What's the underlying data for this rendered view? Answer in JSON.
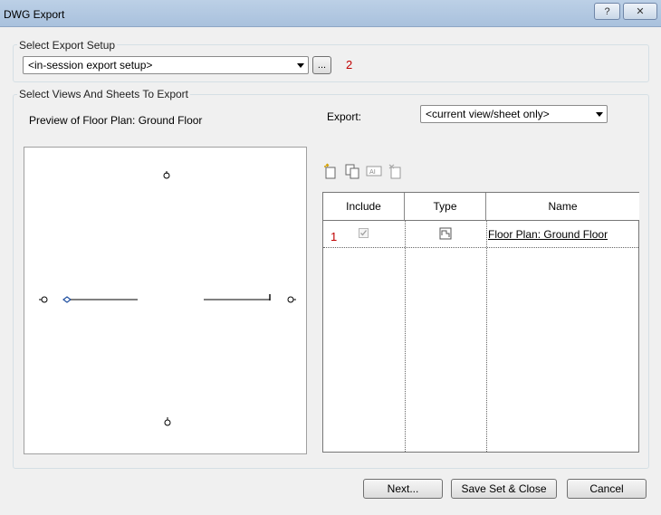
{
  "window": {
    "title": "DWG Export",
    "help_label": "?",
    "close_label": "✕"
  },
  "export_setup": {
    "group_label": "Select Export Setup",
    "selected": "<in-session export setup>",
    "browse_label": "...",
    "annotation": "2"
  },
  "views": {
    "group_label": "Select Views And Sheets To Export",
    "preview_label": "Preview of Floor Plan: Ground Floor",
    "export_label": "Export:",
    "export_selected": "<current view/sheet only>"
  },
  "table": {
    "headers": [
      "Include",
      "Type",
      "Name"
    ],
    "rows": [
      {
        "annotation": "1",
        "include": true,
        "name": "Floor Plan: Ground Floor"
      }
    ]
  },
  "buttons": {
    "next": "Next...",
    "save_close": "Save Set & Close",
    "cancel": "Cancel"
  },
  "colors": {
    "annotation": "#c00000",
    "titlebar": "#a9c1dd"
  }
}
